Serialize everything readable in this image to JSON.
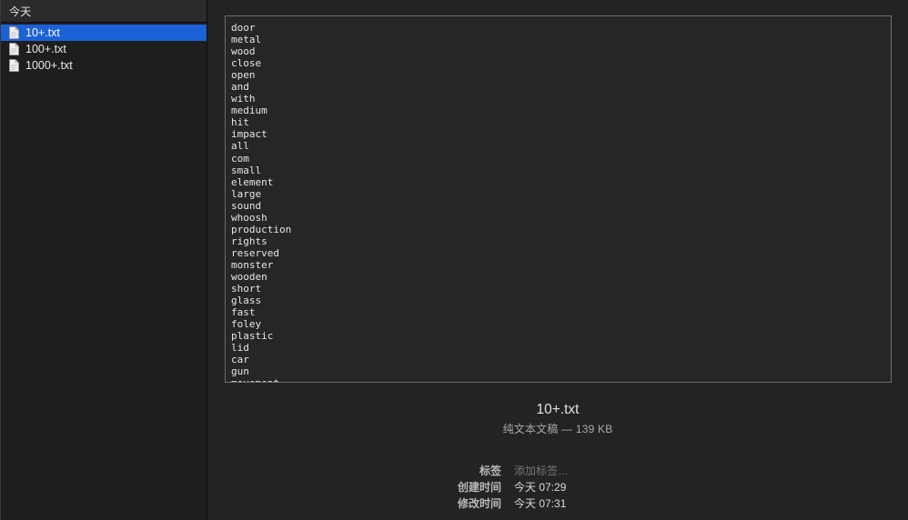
{
  "window": {
    "background": "#232323",
    "accent": "#1b62d6"
  },
  "sidebar": {
    "header": {
      "title": "今天"
    },
    "items": [
      {
        "label": "10+.txt",
        "icon": "document-icon",
        "selected": true
      },
      {
        "label": "100+.txt",
        "icon": "document-icon",
        "selected": false
      },
      {
        "label": "1000+.txt",
        "icon": "document-icon",
        "selected": false
      }
    ]
  },
  "preview": {
    "text_lines": [
      "door",
      "metal",
      "wood",
      "close",
      "open",
      "and",
      "with",
      "medium",
      "hit",
      "impact",
      "all",
      "com",
      "small",
      "element",
      "large",
      "sound",
      "whoosh",
      "production",
      "rights",
      "reserved",
      "monster",
      "wooden",
      "short",
      "glass",
      "fast",
      "foley",
      "plastic",
      "lid",
      "car",
      "gun",
      "movement"
    ]
  },
  "info": {
    "title": "10+.txt",
    "subtitle": "纯文本文稿 — 139 KB",
    "metadata": [
      {
        "label": "标签",
        "value": "添加标签…",
        "placeholder": true
      },
      {
        "label": "创建时间",
        "value": "今天 07:29",
        "placeholder": false
      },
      {
        "label": "修改时间",
        "value": "今天 07:31",
        "placeholder": false
      }
    ]
  }
}
